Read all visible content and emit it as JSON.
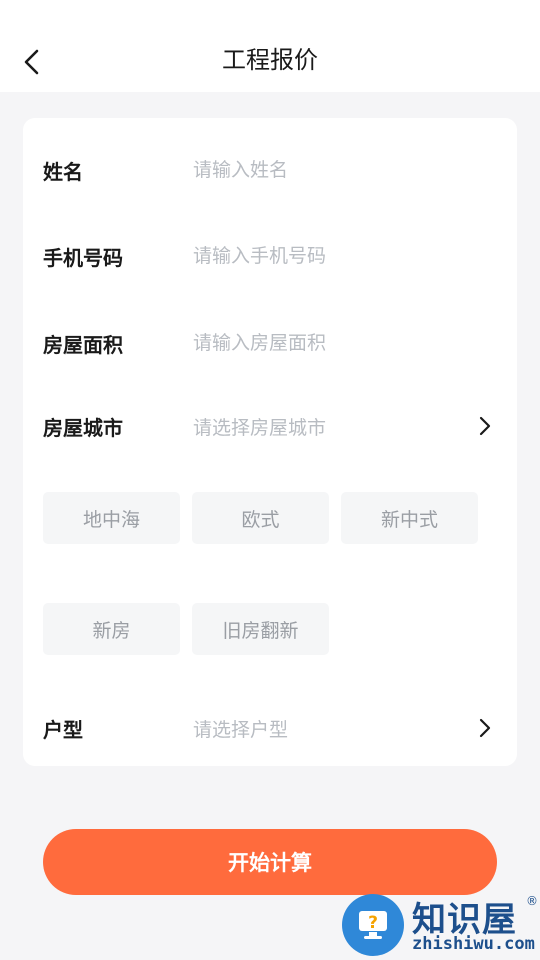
{
  "header": {
    "title": "工程报价",
    "back_icon": "chevron-left-icon"
  },
  "form": {
    "name": {
      "label": "姓名",
      "placeholder": "请输入姓名"
    },
    "phone": {
      "label": "手机号码",
      "placeholder": "请输入手机号码"
    },
    "area": {
      "label": "房屋面积",
      "placeholder": "请输入房屋面积"
    },
    "city": {
      "label": "房屋城市",
      "placeholder": "请选择房屋城市",
      "icon": "chevron-right-icon"
    },
    "styles": [
      "地中海",
      "欧式",
      "新中式"
    ],
    "house_types": [
      "新房",
      "旧房翻新"
    ],
    "layout": {
      "label": "户型",
      "placeholder": "请选择户型",
      "icon": "chevron-right-icon"
    }
  },
  "actions": {
    "calculate_label": "开始计算"
  },
  "watermark": {
    "brand": "知识屋",
    "registered": "®",
    "domain": "zhishiwu.com"
  },
  "colors": {
    "accent": "#ff6b3d",
    "background": "#f5f5f7",
    "card": "#ffffff",
    "chip_bg": "#f5f6f7",
    "placeholder": "#b8bcc2",
    "watermark": "#1d4f8c"
  }
}
